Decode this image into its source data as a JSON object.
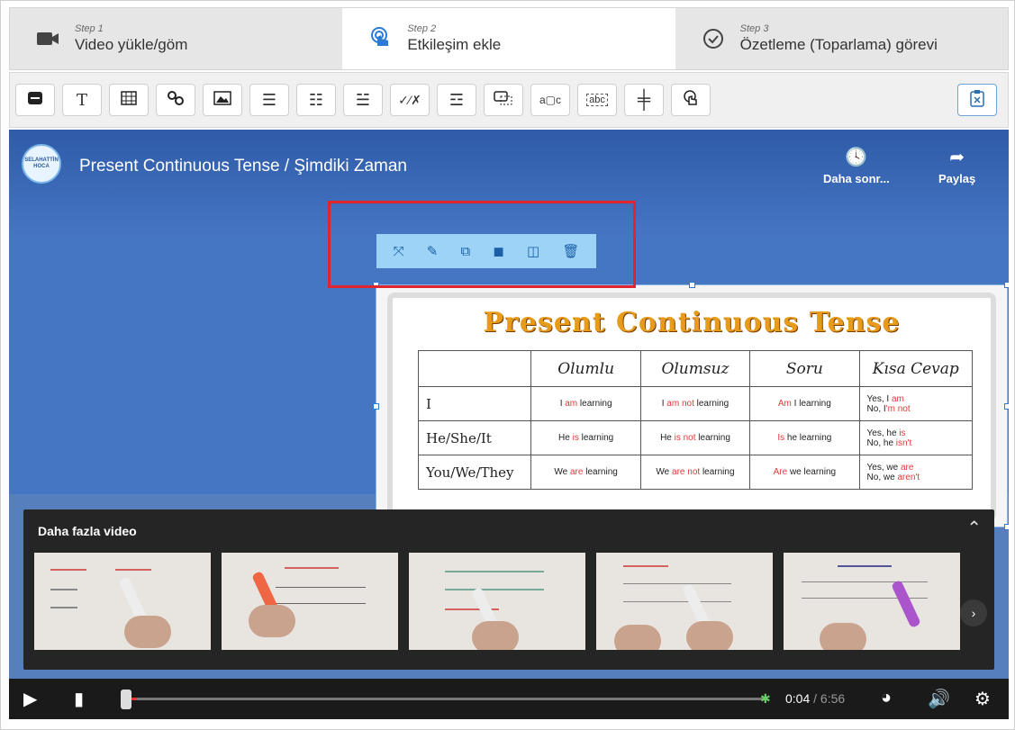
{
  "steps": [
    {
      "step": "Step 1",
      "label": "Video yükle/göm",
      "icon": "video-camera-icon"
    },
    {
      "step": "Step 2",
      "label": "Etkileşim ekle",
      "icon": "touch-icon"
    },
    {
      "step": "Step 3",
      "label": "Özetleme (Toparlama) görevi",
      "icon": "check-circle-icon"
    }
  ],
  "toolbar": {
    "text_tool": "T",
    "fill_blank": "a▢c",
    "text_field": "abc"
  },
  "video": {
    "title": "Present Continuous Tense / Şimdiki Zaman",
    "channel": "SELAHATTİN HOCA",
    "watch_later": "Daha sonr...",
    "share": "Paylaş",
    "more_videos": "Daha fazla video",
    "time_current": "0:04",
    "time_sep": " / ",
    "time_total": "6:56"
  },
  "grammar_table": {
    "title": "Present Continuous Tense",
    "headers": [
      "",
      "Olumlu",
      "Olumsuz",
      "Soru",
      "Kısa Cevap"
    ],
    "rows": [
      {
        "pronoun": "I",
        "pos_a": "I ",
        "pos_b": "am",
        "pos_c": " learning",
        "neg_a": "I ",
        "neg_b": "am not",
        "neg_c": " learning",
        "q_a": "Am",
        "q_b": " I learning",
        "s1a": "Yes, I ",
        "s1b": "am",
        "s2a": "No, I",
        "s2b": "'m not"
      },
      {
        "pronoun": "He/She/It",
        "pos_a": "He ",
        "pos_b": "is",
        "pos_c": " learning",
        "neg_a": "He ",
        "neg_b": "is not",
        "neg_c": " learning",
        "q_a": "Is",
        "q_b": " he learning",
        "s1a": "Yes, he ",
        "s1b": "is",
        "s2a": "No, he ",
        "s2b": "isn't"
      },
      {
        "pronoun": "You/We/They",
        "pos_a": "We ",
        "pos_b": "are",
        "pos_c": " learning",
        "neg_a": "We ",
        "neg_b": "are not",
        "neg_c": " learning",
        "q_a": "Are",
        "q_b": " we learning",
        "s1a": "Yes, we ",
        "s1b": "are",
        "s2a": "No, we ",
        "s2b": "aren't"
      }
    ]
  },
  "colors": {
    "accent": "#4576c4",
    "highlight": "#e0262c",
    "tool_bg": "#9cd3f7"
  }
}
